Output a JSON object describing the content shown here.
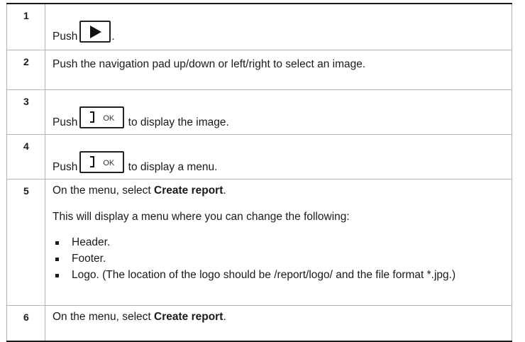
{
  "steps": [
    {
      "num": "1",
      "pre": "Push",
      "post": "."
    },
    {
      "num": "2",
      "text": "Push the navigation pad up/down or left/right to select an image."
    },
    {
      "num": "3",
      "pre": "Push",
      "post": "to display the image.",
      "key": "OK"
    },
    {
      "num": "4",
      "pre": "Push",
      "post": "to display a menu.",
      "key": "OK"
    },
    {
      "num": "5",
      "lead": "On the menu, select",
      "bold": "Create report",
      "end": ".",
      "para": "This will display a menu where you can change the following:",
      "options": [
        "Header.",
        "Footer.",
        "Logo. (The location of the logo should be /report/logo/ and the file format *.jpg.)"
      ]
    },
    {
      "num": "6",
      "lead": "On the menu, select",
      "bold": "Create report",
      "end": "."
    }
  ],
  "icons": {
    "play": "play-icon",
    "ok": "ok-button-icon"
  }
}
